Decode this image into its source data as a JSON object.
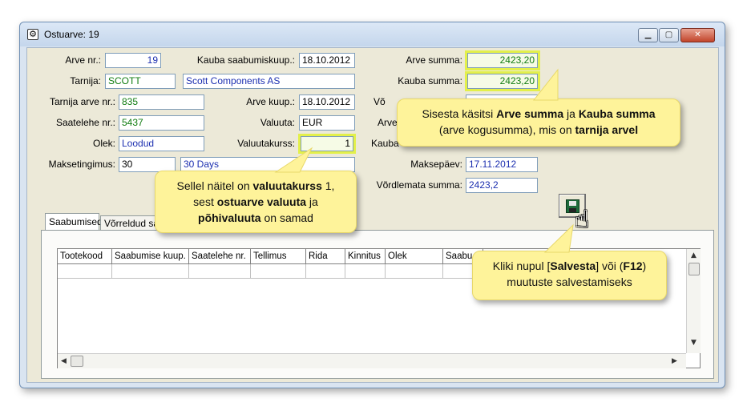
{
  "window": {
    "title": "Ostuarve: 19",
    "title_icon": "app-icon",
    "min_glyph": "▁",
    "max_glyph": "▢",
    "close_glyph": "✕"
  },
  "form": {
    "arve_nr": {
      "label": "Arve nr.:",
      "value": "19"
    },
    "tarnija": {
      "label": "Tarnija:",
      "code": "SCOTT",
      "name": "Scott Components AS"
    },
    "tarnija_arve_nr": {
      "label": "Tarnija arve nr.:",
      "value": "835"
    },
    "saatelehe_nr": {
      "label": "Saatelehe nr.:",
      "value": "5437"
    },
    "olek": {
      "label": "Olek:",
      "value": "Loodud"
    },
    "maksetingimus": {
      "label": "Maksetingimus:",
      "code": "30",
      "name": "30 Days"
    },
    "kauba_saabumiskuup": {
      "label": "Kauba saabumiskuup.:",
      "value": "18.10.2012"
    },
    "arve_kuup": {
      "label": "Arve kuup.:",
      "value": "18.10.2012"
    },
    "valuuta": {
      "label": "Valuuta:",
      "value": "EUR"
    },
    "valuutakurss": {
      "label": "Valuutakurss:",
      "value": "1"
    },
    "arve_summa": {
      "label": "Arve summa:",
      "value": "2423,20"
    },
    "kauba_summa": {
      "label": "Kauba summa:",
      "value": "2423,20"
    },
    "vordlemata_label_partial": "Võ",
    "arve_partial": "Arve",
    "kauba_partial": "Kauba",
    "maksepaev": {
      "label": "Maksepäev:",
      "value": "17.11.2012"
    },
    "vordlemata_summa": {
      "label": "Võrdlemata summa:",
      "value": "2423,2"
    }
  },
  "tabs": [
    {
      "label": "Saabumised"
    },
    {
      "label": "Võrreldud sa"
    }
  ],
  "grid": {
    "columns": [
      "Tootekood",
      "Saabumise kuup.",
      "Saatelehe nr.",
      "Tellimus",
      "Rida",
      "Kinnitus",
      "Olek",
      "Saabu"
    ]
  },
  "scrollbars": {
    "up": "▲",
    "down": "▼",
    "left": "◀",
    "right": "▶"
  },
  "save_button": {
    "icon": "floppy-disk-icon",
    "cursor": "☝"
  },
  "callouts": {
    "sums": {
      "t1": "Sisesta käsitsi ",
      "b1": "Arve summa",
      "t2": " ja ",
      "b2": "Kauba summa",
      "t3": "(arve kogusumma), mis on ",
      "b3": "tarnija arvel"
    },
    "rate": {
      "t1": "Sellel näitel on ",
      "b1": "valuutakurss",
      "t2": " 1,",
      "t3": "sest ",
      "b2": "ostuarve valuuta",
      "t4": " ja",
      "b3": "põhivaluuta",
      "t5": " on samad"
    },
    "save": {
      "t1": "Kliki nupul [",
      "b1": "Salvesta",
      "t2": "] või (",
      "b2": "F12",
      "t3": ")",
      "t4": "muutuste salvestamiseks"
    }
  },
  "colors": {
    "callout_bg": "#fef39a",
    "highlight": "#e3f04a",
    "value_green": "#107c10",
    "value_blue": "#1c2fb0"
  }
}
